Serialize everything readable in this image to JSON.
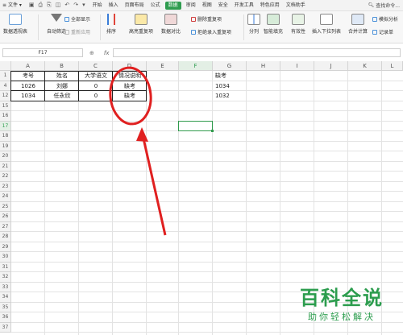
{
  "menubar": {
    "file": "文件",
    "items": [
      "开始",
      "插入",
      "页面布局",
      "公式",
      "数据",
      "审阅",
      "视图",
      "安全",
      "开发工具",
      "特色应用",
      "文档助手"
    ],
    "active_index": 4,
    "search": "查找命令..."
  },
  "ribbon": {
    "pivot": "数据透视表",
    "autofilter": "自动筛选",
    "show_all": "全部显示",
    "reapply": "重新应用",
    "sort": "排序",
    "highlight_dup": "高亮重复项",
    "data_compare": "数据对比",
    "remove_dup": "删除重复项",
    "reject_dup": "拒绝录入重复项",
    "split": "分列",
    "smart_fill": "智能填充",
    "validity": "有效性",
    "dropdown": "插入下拉列表",
    "consolidate": "合并计算",
    "what_if": "模拟分析",
    "record": "记录单"
  },
  "formula_bar": {
    "name_box": "F17",
    "fx": "fx",
    "formula": ""
  },
  "grid": {
    "columns": [
      "A",
      "B",
      "C",
      "D",
      "E",
      "F",
      "G",
      "H",
      "I",
      "J",
      "K",
      "L"
    ],
    "selected_column": "F",
    "rows": [
      "1",
      "4",
      "12",
      "15",
      "16",
      "17",
      "18",
      "19",
      "20",
      "21",
      "22",
      "23",
      "24",
      "25",
      "26",
      "27",
      "28",
      "29",
      "30",
      "31",
      "32",
      "33",
      "34",
      "35",
      "36",
      "37"
    ],
    "selected_row": "17",
    "selected_cell": "F17",
    "cells": {
      "A1": "考号",
      "B1": "姓名",
      "C1": "大学语文",
      "D1": "情况说明",
      "G1": "缺考",
      "A4": "1026",
      "B4": "刘娜",
      "C4": "0",
      "D4": "缺考",
      "G4": "1034",
      "A12": "1034",
      "B12": "任永欣",
      "C12": "0",
      "D12": "缺考",
      "G12": "1032"
    }
  },
  "watermark": {
    "title": "百科全说",
    "subtitle": "助你轻松解决"
  },
  "colors": {
    "accent": "#2e9c4f",
    "annotation": "#e02020"
  }
}
